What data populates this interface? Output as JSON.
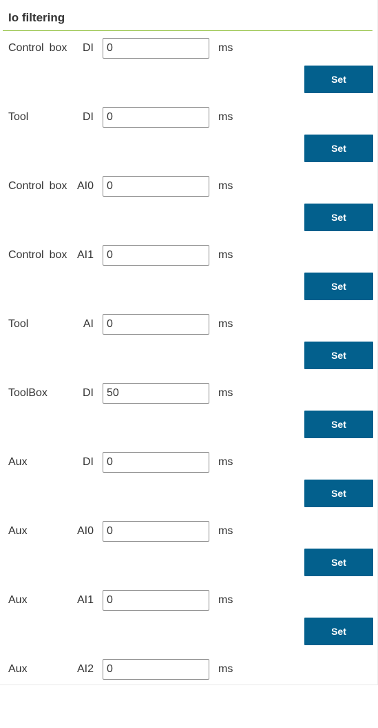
{
  "section": {
    "title": "Io filtering"
  },
  "rows": [
    {
      "group": [
        "Control",
        "box"
      ],
      "channel": "DI",
      "value": "0",
      "unit": "ms",
      "button": "Set"
    },
    {
      "group": [
        "Tool"
      ],
      "channel": "DI",
      "value": "0",
      "unit": "ms",
      "button": "Set"
    },
    {
      "group": [
        "Control",
        "box"
      ],
      "channel": "AI0",
      "value": "0",
      "unit": "ms",
      "button": "Set"
    },
    {
      "group": [
        "Control",
        "box"
      ],
      "channel": "AI1",
      "value": "0",
      "unit": "ms",
      "button": "Set"
    },
    {
      "group": [
        "Tool"
      ],
      "channel": "AI",
      "value": "0",
      "unit": "ms",
      "button": "Set"
    },
    {
      "group": [
        "ToolBox"
      ],
      "channel": "DI",
      "value": "50",
      "unit": "ms",
      "button": "Set"
    },
    {
      "group": [
        "Aux"
      ],
      "channel": "DI",
      "value": "0",
      "unit": "ms",
      "button": "Set"
    },
    {
      "group": [
        "Aux"
      ],
      "channel": "AI0",
      "value": "0",
      "unit": "ms",
      "button": "Set"
    },
    {
      "group": [
        "Aux"
      ],
      "channel": "AI1",
      "value": "0",
      "unit": "ms",
      "button": "Set"
    },
    {
      "group": [
        "Aux"
      ],
      "channel": "AI2",
      "value": "0",
      "unit": "ms",
      "button": null
    }
  ],
  "colors": {
    "accent_rule": "#8fbf3c",
    "button_bg": "#03608d",
    "button_text": "#ffffff"
  }
}
